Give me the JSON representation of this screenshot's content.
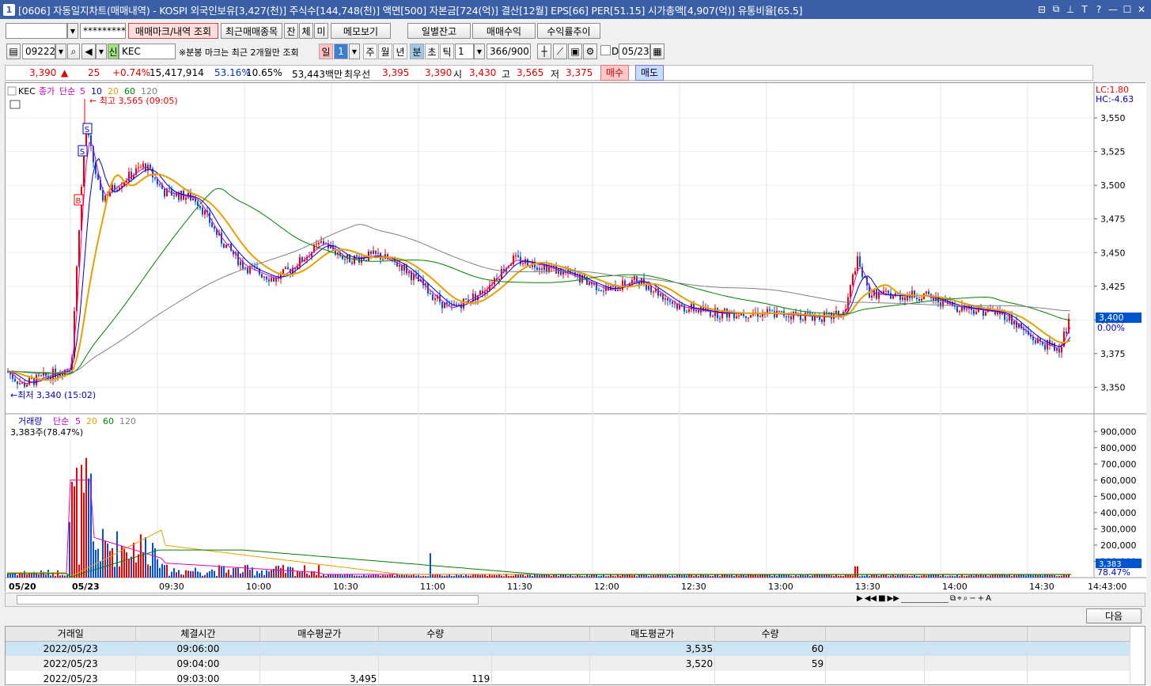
{
  "window": {
    "app_num": "1",
    "title": "[0606] 자동일지차트(매매내역) - KOSPI 외국인보유[3,427(천)] 주식수[144,748(천)] 액면[500] 자본금[724(억)] 결산[12월] EPS[66] PER[51.15] 시가총액[4,907(억)] 유통비율[65.5]",
    "title_icons": [
      "window-icon",
      "copy-icon",
      "pin-icon",
      "font-icon",
      "help-icon",
      "minimize-icon",
      "maximize-icon",
      "close-icon"
    ],
    "title_icon_glyphs": [
      "⊟",
      "⧉",
      "⊥",
      "T",
      "?",
      "—",
      "☐",
      "✕"
    ]
  },
  "toolbar1": {
    "account_value": "",
    "password_value": "*********",
    "btn_trade_mark": "매매마크/내역 조회",
    "btn_recent": "최근매매종목",
    "btn_jan": "잔",
    "btn_che": "체",
    "btn_mi": "미",
    "btn_memo": "메모보기",
    "btn_daily": "일별잔고",
    "btn_profit": "매매수익",
    "btn_return": "수익률추이"
  },
  "toolbar2": {
    "code": "092220",
    "sin": "신",
    "stock_name": "KEC",
    "note": "※분봉 마크는 최근 2개월만 조회",
    "period_tabs": [
      "일",
      "1",
      "주",
      "월",
      "년",
      "분",
      "초",
      "틱"
    ],
    "interval": "1",
    "count": "366/900",
    "d_label": "D",
    "date": "05/23"
  },
  "infobar": {
    "price": "3,390",
    "up_arrow": "▲",
    "change": "25",
    "change_pct": "+0.74%",
    "volume": "15,417,914",
    "vol_pct": "53.16%",
    "turnover": "10.65%",
    "amount": "53,443백만",
    "best_label": "최우선",
    "ask": "3,395",
    "bid": "3,390",
    "open_label": "시",
    "open": "3,430",
    "high_label": "고",
    "high": "3,565",
    "low_label": "저",
    "low": "3,375",
    "buy_btn": "매수",
    "sell_btn": "매도"
  },
  "price_chart": {
    "name": "KEC",
    "legend_price": "종가",
    "legend_ma": "단순",
    "ma_periods": [
      "5",
      "10",
      "20",
      "60",
      "120"
    ],
    "ma_colors": [
      "#e000c0",
      "#0000c0",
      "#e8a000",
      "#008000",
      "#808080"
    ],
    "high_note": "최고 3,565 (09:05)",
    "low_note": "최저 3,340 (15:02)",
    "lc": "LC:1.80",
    "hc": "HC:-4.63",
    "current_price_tag": "3,400",
    "current_pct_tag": "0.00%",
    "y_ticks": [
      "3,550",
      "3,525",
      "3,500",
      "3,475",
      "3,450",
      "3,425",
      "3,400",
      "3,375",
      "3,350"
    ],
    "marks": [
      "S",
      "S",
      "B"
    ]
  },
  "volume_chart": {
    "legend_name": "거래량",
    "legend_ma": "단순",
    "ma_periods": [
      "5",
      "20",
      "60",
      "120"
    ],
    "last_note": "3,383주(78.47%)",
    "y_ticks": [
      "900,000",
      "800,000",
      "700,000",
      "600,000",
      "500,000",
      "400,000",
      "300,000",
      "200,000",
      "100,000"
    ],
    "current_tag": "3,383",
    "pct_tag": "78.47%"
  },
  "x_axis": [
    "05/20",
    "05/23",
    "09:30",
    "10:00",
    "10:30",
    "11:00",
    "11:30",
    "12:00",
    "12:30",
    "13:00",
    "13:30",
    "14:00",
    "14:30",
    "14:43:00"
  ],
  "next_button": "다음",
  "table": {
    "headers": [
      "거래일",
      "체결시간",
      "매수평균가",
      "수량",
      "",
      "매도평균가",
      "수량",
      "",
      "",
      ""
    ],
    "rows": [
      [
        "2022/05/23",
        "09:06:00",
        "",
        "",
        "",
        "3,535",
        "60",
        "",
        "",
        ""
      ],
      [
        "2022/05/23",
        "09:04:00",
        "",
        "",
        "",
        "3,520",
        "59",
        "",
        "",
        ""
      ],
      [
        "2022/05/23",
        "09:03:00",
        "3,495",
        "119",
        "",
        "",
        "",
        "",
        "",
        ""
      ]
    ]
  }
}
